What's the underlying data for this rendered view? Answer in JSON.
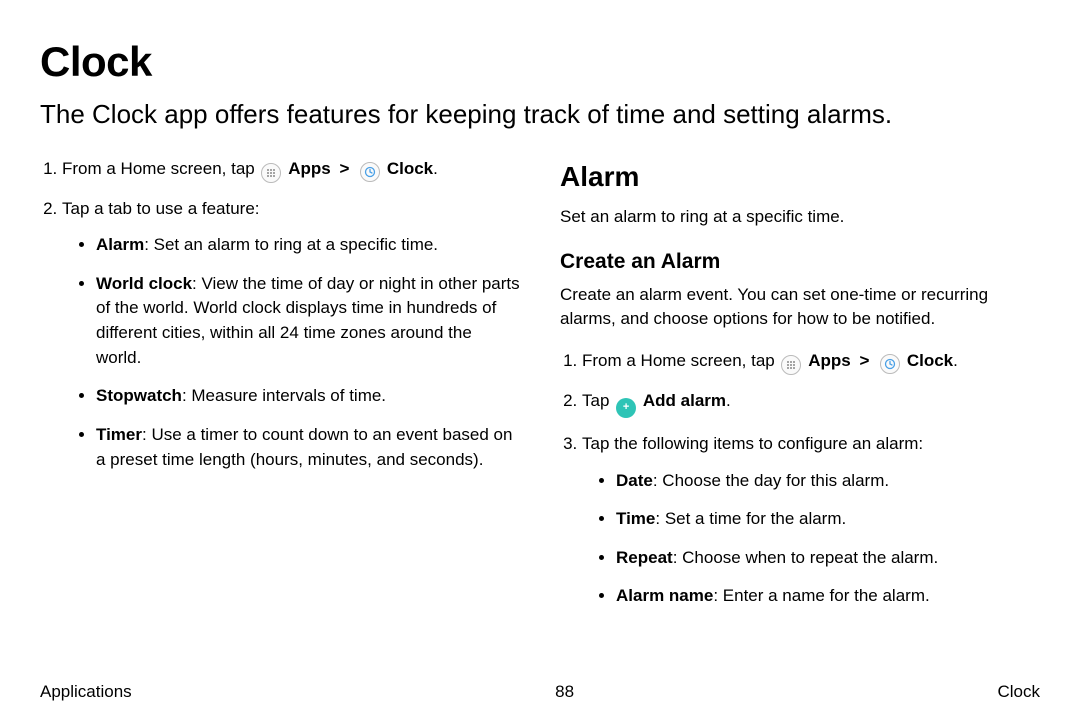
{
  "title": "Clock",
  "intro": "The Clock app offers features for keeping track of time and setting alarms.",
  "left": {
    "step1_pre": "From a Home screen, tap ",
    "apps_label": "Apps",
    "step1_sep": ">",
    "clock_label": "Clock",
    "step2": "Tap a tab to use a feature:",
    "features": {
      "alarm_t": "Alarm",
      "alarm_d": ": Set an alarm to ring at a specific time.",
      "world_t": "World clock",
      "world_d": ": View the time of day or night in other parts of the world. World clock displays time in hundreds of different cities, within all 24 time zones around the world.",
      "stop_t": "Stopwatch",
      "stop_d": ": Measure intervals of time.",
      "timer_t": "Timer",
      "timer_d": ": Use a timer to count down to an event based on a preset time length (hours, minutes, and seconds)."
    }
  },
  "right": {
    "h2": "Alarm",
    "desc": "Set an alarm to ring at a specific time.",
    "h3": "Create an Alarm",
    "create_desc": "Create an alarm event. You can set one-time or recurring alarms, and choose options for how to be notified.",
    "step1_pre": "From a Home screen, tap ",
    "apps_label": "Apps",
    "step1_sep": ">",
    "clock_label": "Clock",
    "step2_pre": "Tap ",
    "add_label": "Add alarm",
    "step3": "Tap the following items to configure an alarm:",
    "opts": {
      "date_t": "Date",
      "date_d": ": Choose the day for this alarm.",
      "time_t": "Time",
      "time_d": ": Set a time for the alarm.",
      "repeat_t": "Repeat",
      "repeat_d": ": Choose when to repeat the alarm.",
      "name_t": "Alarm name",
      "name_d": ": Enter a name for the alarm."
    }
  },
  "footer": {
    "left": "Applications",
    "center": "88",
    "right": "Clock"
  }
}
